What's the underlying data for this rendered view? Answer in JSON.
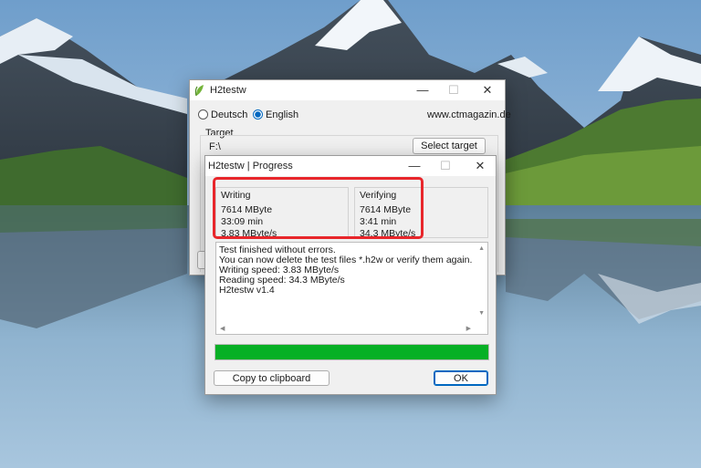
{
  "main_window": {
    "title": "H2testw",
    "language_options": [
      "Deutsch",
      "English"
    ],
    "selected_language": "English",
    "website": "www.ctmagazin.de",
    "target_label": "Target",
    "target_path": "F:\\",
    "select_target_label": "Select target",
    "min_glyph": "—",
    "max_glyph": "☐",
    "close_glyph": "✕"
  },
  "progress_dialog": {
    "title": "H2testw | Progress",
    "writing": {
      "header": "Writing",
      "size": "7614 MByte",
      "time": "33:09 min",
      "speed": "3.83 MByte/s"
    },
    "verifying": {
      "header": "Verifying",
      "size": "7614 MByte",
      "time": "3:41 min",
      "speed": "34.3 MByte/s"
    },
    "log_lines": [
      "Test finished without errors.",
      "You can now delete the test files *.h2w or verify them again.",
      "Writing speed: 3.83 MByte/s",
      "Reading speed: 34.3 MByte/s",
      "H2testw v1.4"
    ],
    "progress_fraction": 1.0,
    "copy_label": "Copy to clipboard",
    "ok_label": "OK",
    "min_glyph": "—",
    "max_glyph": "☐",
    "close_glyph": "✕"
  },
  "colors": {
    "progress_fill": "#06b025",
    "highlight": "#e8262b",
    "accent": "#0067c0"
  },
  "icons": {
    "app_icon": "h2testw-leaf-icon",
    "scroll_up": "chevron-up-icon",
    "scroll_down": "chevron-down-icon",
    "scroll_left": "chevron-left-icon",
    "scroll_right": "chevron-right-icon"
  }
}
